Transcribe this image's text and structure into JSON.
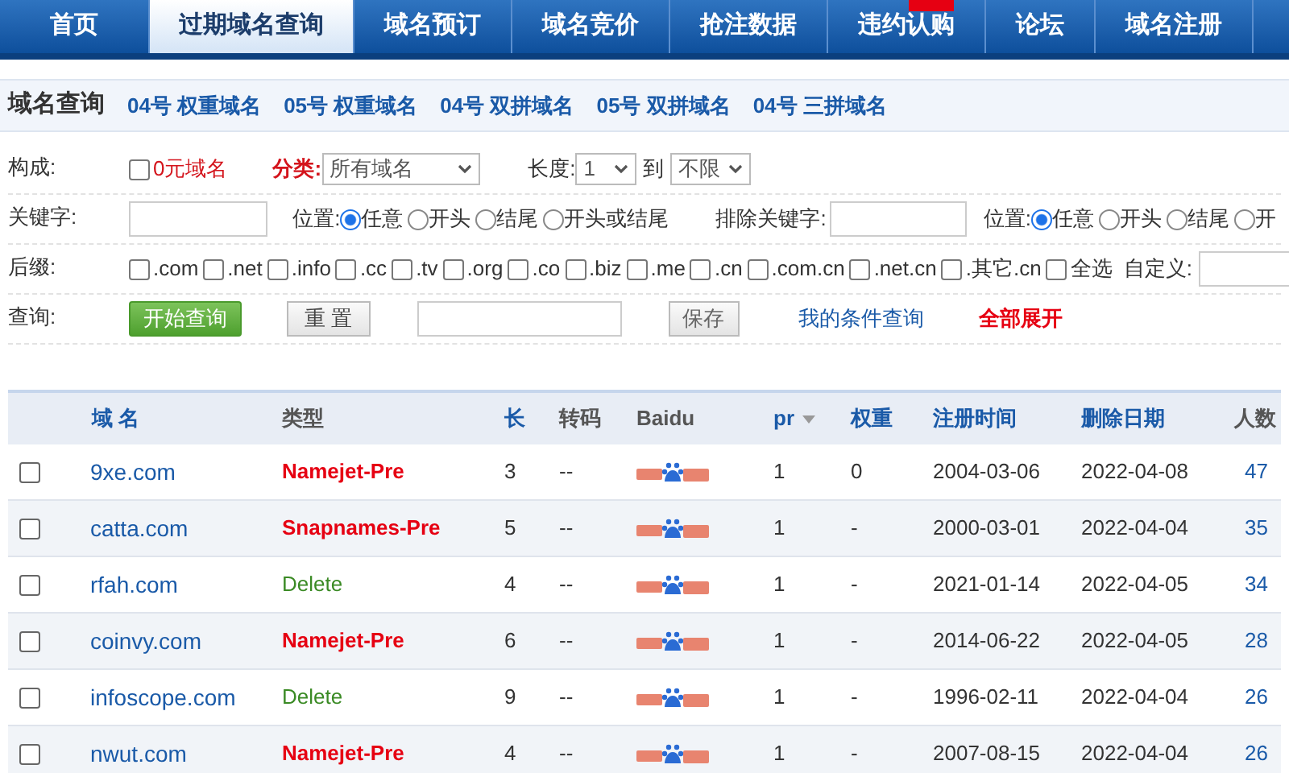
{
  "nav": {
    "tabs": [
      {
        "label": "首页",
        "selected": false
      },
      {
        "label": "过期域名查询",
        "selected": true
      },
      {
        "label": "域名预订",
        "selected": false
      },
      {
        "label": "域名竞价",
        "selected": false
      },
      {
        "label": "抢注数据",
        "selected": false
      },
      {
        "label": "违约认购",
        "selected": false,
        "badge": true
      },
      {
        "label": "论坛",
        "selected": false
      },
      {
        "label": "域名注册",
        "selected": false
      }
    ]
  },
  "subnav": {
    "title": "域名查询",
    "links": [
      "04号 权重域名",
      "05号 权重域名",
      "04号 双拼域名",
      "05号 双拼域名",
      "04号 三拼域名"
    ]
  },
  "form": {
    "composition": {
      "label": "构成:",
      "zero_price": {
        "label": "0元域名",
        "checked": false
      },
      "category_label": "分类:",
      "category": "所有域名",
      "length_label": "长度:",
      "length_from": "1",
      "to_label": "到",
      "length_to": "不限"
    },
    "keyword": {
      "label": "关键字:",
      "position_label": "位置:",
      "positions": [
        {
          "label": "任意",
          "selected": true
        },
        {
          "label": "开头",
          "selected": false
        },
        {
          "label": "结尾",
          "selected": false
        },
        {
          "label": "开头或结尾",
          "selected": false
        }
      ],
      "exclude_label": "排除关键字:",
      "exclude_position_label": "位置:",
      "exclude_positions": [
        {
          "label": "任意",
          "selected": true
        },
        {
          "label": "开头",
          "selected": false
        },
        {
          "label": "结尾",
          "selected": false
        },
        {
          "label": "开",
          "selected": false
        }
      ]
    },
    "suffix": {
      "label": "后缀:",
      "options": [
        {
          "label": ".com",
          "checked": false
        },
        {
          "label": ".net",
          "checked": false
        },
        {
          "label": ".info",
          "checked": false
        },
        {
          "label": ".cc",
          "checked": false
        },
        {
          "label": ".tv",
          "checked": false
        },
        {
          "label": ".org",
          "checked": false
        },
        {
          "label": ".co",
          "checked": false
        },
        {
          "label": ".biz",
          "checked": false
        },
        {
          "label": ".me",
          "checked": false
        },
        {
          "label": ".cn",
          "checked": false
        },
        {
          "label": ".com.cn",
          "checked": false
        },
        {
          "label": ".net.cn",
          "checked": false
        },
        {
          "label": ".其它.cn",
          "checked": false
        },
        {
          "label": "全选",
          "checked": false
        }
      ],
      "custom_label": "自定义:"
    },
    "query": {
      "label": "查询:",
      "search_button": "开始查询",
      "reset_button": "重 置",
      "save_button": "保存",
      "my_queries_link": "我的条件查询",
      "expand_all_link": "全部展开"
    }
  },
  "table": {
    "columns": [
      "域 名",
      "类型",
      "长",
      "转码",
      "Baidu",
      "pr",
      "权重",
      "注册时间",
      "删除日期",
      "人数"
    ],
    "rows": [
      {
        "checked": false,
        "domain": "9xe.com",
        "type": "Namejet-Pre",
        "kind": "pre",
        "length": "3",
        "transcode": "--",
        "pr": "1",
        "weight": "0",
        "registered": "2004-03-06",
        "deleted": "2022-04-08",
        "people": "47"
      },
      {
        "checked": false,
        "domain": "catta.com",
        "type": "Snapnames-Pre",
        "kind": "pre",
        "length": "5",
        "transcode": "--",
        "pr": "1",
        "weight": "-",
        "registered": "2000-03-01",
        "deleted": "2022-04-04",
        "people": "35"
      },
      {
        "checked": false,
        "domain": "rfah.com",
        "type": "Delete",
        "kind": "delete",
        "length": "4",
        "transcode": "--",
        "pr": "1",
        "weight": "-",
        "registered": "2021-01-14",
        "deleted": "2022-04-05",
        "people": "34"
      },
      {
        "checked": false,
        "domain": "coinvy.com",
        "type": "Namejet-Pre",
        "kind": "pre",
        "length": "6",
        "transcode": "--",
        "pr": "1",
        "weight": "-",
        "registered": "2014-06-22",
        "deleted": "2022-04-05",
        "people": "28"
      },
      {
        "checked": false,
        "domain": "infoscope.com",
        "type": "Delete",
        "kind": "delete",
        "length": "9",
        "transcode": "--",
        "pr": "1",
        "weight": "-",
        "registered": "1996-02-11",
        "deleted": "2022-04-04",
        "people": "26"
      },
      {
        "checked": false,
        "domain": "nwut.com",
        "type": "Namejet-Pre",
        "kind": "pre",
        "length": "4",
        "transcode": "--",
        "pr": "1",
        "weight": "-",
        "registered": "2007-08-15",
        "deleted": "2022-04-04",
        "people": "26"
      }
    ]
  }
}
